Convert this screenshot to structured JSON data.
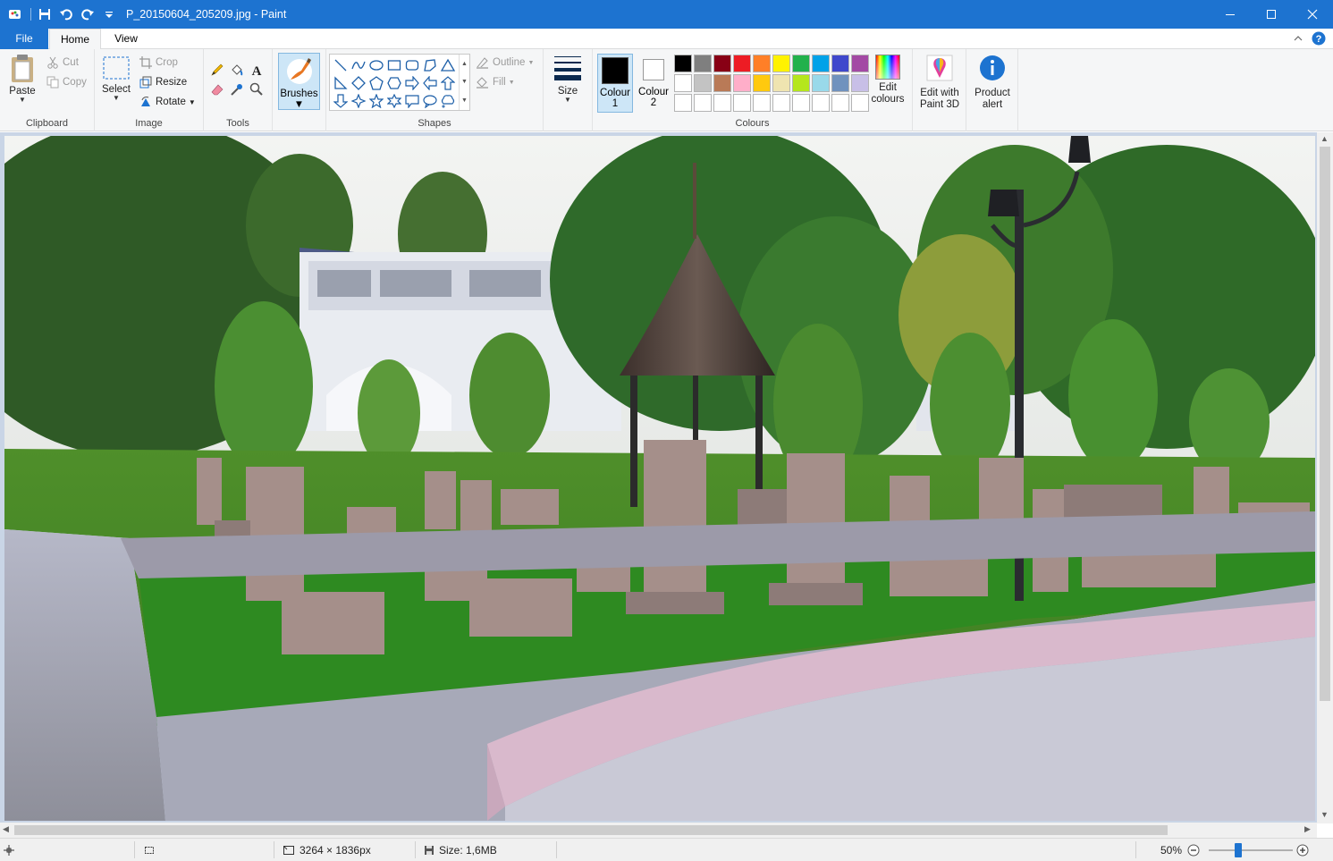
{
  "window": {
    "title": "P_20150604_205209.jpg - Paint",
    "accent_color": "#1d73d0"
  },
  "tabs": {
    "file": "File",
    "home": "Home",
    "view": "View"
  },
  "ribbon": {
    "clipboard": {
      "label": "Clipboard",
      "paste": "Paste",
      "cut": "Cut",
      "copy": "Copy"
    },
    "image": {
      "label": "Image",
      "select": "Select",
      "crop": "Crop",
      "resize": "Resize",
      "rotate": "Rotate"
    },
    "tools": {
      "label": "Tools"
    },
    "brushes": {
      "label": "Brushes"
    },
    "shapes": {
      "label": "Shapes",
      "outline": "Outline",
      "fill": "Fill"
    },
    "size": {
      "label": "Size"
    },
    "colours": {
      "label": "Colours",
      "colour1": "Colour",
      "colour1_num": "1",
      "colour2": "Colour",
      "colour2_num": "2",
      "edit_colours_line1": "Edit",
      "edit_colours_line2": "colours",
      "palette_row1": [
        "#000000",
        "#7f7f7f",
        "#880015",
        "#ed1c24",
        "#ff7f27",
        "#fff200",
        "#22b14c",
        "#00a2e8",
        "#3f48cc",
        "#a349a4"
      ],
      "palette_row2": [
        "#ffffff",
        "#c3c3c3",
        "#b97a57",
        "#ffaec9",
        "#ffc90e",
        "#efe4b0",
        "#b5e61d",
        "#99d9ea",
        "#7092be",
        "#c8bfe7"
      ],
      "palette_row3": [
        "#ffffff",
        "#ffffff",
        "#ffffff",
        "#ffffff",
        "#ffffff",
        "#ffffff",
        "#ffffff",
        "#ffffff",
        "#ffffff",
        "#ffffff"
      ],
      "colour1_value": "#000000",
      "colour2_value": "#ffffff"
    },
    "paint3d": {
      "line1": "Edit with",
      "line2": "Paint 3D"
    },
    "product_alert": {
      "line1": "Product",
      "line2": "alert"
    }
  },
  "status": {
    "dimensions": "3264 × 1836px",
    "size": "Size: 1,6MB",
    "zoom": "50%",
    "zoom_fraction": 0.5
  }
}
